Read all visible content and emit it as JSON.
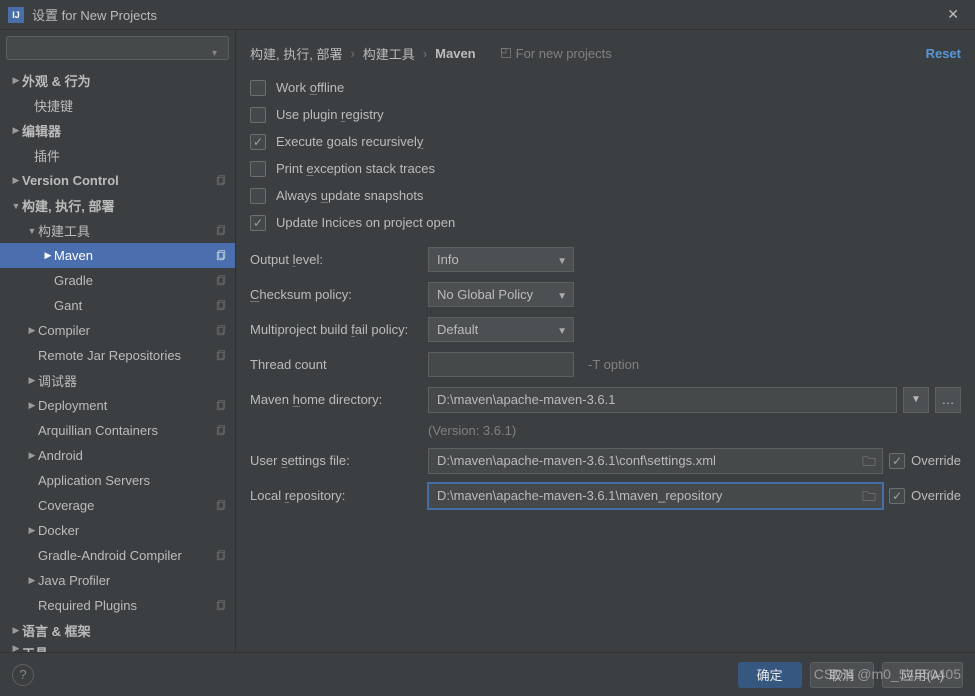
{
  "title": "设置 for New Projects",
  "reset": "Reset",
  "breadcrumb": [
    "构建, 执行, 部署",
    "构建工具",
    "Maven"
  ],
  "for_new_projects": "For new projects",
  "sidebar": [
    {
      "label": "外观 & 行为",
      "lvl": 0,
      "arrow": "right",
      "bold": true,
      "copy": false
    },
    {
      "label": "快捷键",
      "lvl": 0,
      "arrow": "",
      "bold": false,
      "copy": false,
      "extra_left": true
    },
    {
      "label": "编辑器",
      "lvl": 0,
      "arrow": "right",
      "bold": true,
      "copy": false
    },
    {
      "label": "插件",
      "lvl": 0,
      "arrow": "",
      "bold": false,
      "copy": false,
      "extra_left": true
    },
    {
      "label": "Version Control",
      "lvl": 0,
      "arrow": "right",
      "bold": true,
      "copy": true
    },
    {
      "label": "构建, 执行, 部署",
      "lvl": 0,
      "arrow": "down",
      "bold": true,
      "copy": false
    },
    {
      "label": "构建工具",
      "lvl": 1,
      "arrow": "down",
      "bold": false,
      "copy": true
    },
    {
      "label": "Maven",
      "lvl": 2,
      "arrow": "right",
      "bold": false,
      "copy": true,
      "selected": true
    },
    {
      "label": "Gradle",
      "lvl": 2,
      "arrow": "",
      "bold": false,
      "copy": true
    },
    {
      "label": "Gant",
      "lvl": 2,
      "arrow": "",
      "bold": false,
      "copy": true
    },
    {
      "label": "Compiler",
      "lvl": 1,
      "arrow": "right",
      "bold": false,
      "copy": true
    },
    {
      "label": "Remote Jar Repositories",
      "lvl": 1,
      "arrow": "",
      "bold": false,
      "copy": true
    },
    {
      "label": "调试器",
      "lvl": 1,
      "arrow": "right",
      "bold": false,
      "copy": false
    },
    {
      "label": "Deployment",
      "lvl": 1,
      "arrow": "right",
      "bold": false,
      "copy": true
    },
    {
      "label": "Arquillian Containers",
      "lvl": 1,
      "arrow": "",
      "bold": false,
      "copy": true
    },
    {
      "label": "Android",
      "lvl": 1,
      "arrow": "right",
      "bold": false,
      "copy": false
    },
    {
      "label": "Application Servers",
      "lvl": 1,
      "arrow": "",
      "bold": false,
      "copy": false
    },
    {
      "label": "Coverage",
      "lvl": 1,
      "arrow": "",
      "bold": false,
      "copy": true
    },
    {
      "label": "Docker",
      "lvl": 1,
      "arrow": "right",
      "bold": false,
      "copy": false
    },
    {
      "label": "Gradle-Android Compiler",
      "lvl": 1,
      "arrow": "",
      "bold": false,
      "copy": true
    },
    {
      "label": "Java Profiler",
      "lvl": 1,
      "arrow": "right",
      "bold": false,
      "copy": false
    },
    {
      "label": "Required Plugins",
      "lvl": 1,
      "arrow": "",
      "bold": false,
      "copy": true
    },
    {
      "label": "语言 & 框架",
      "lvl": 0,
      "arrow": "right",
      "bold": true,
      "copy": false
    },
    {
      "label": "工具",
      "lvl": 0,
      "arrow": "right",
      "bold": true,
      "copy": false,
      "cut": true
    }
  ],
  "checks": {
    "work_offline": {
      "pre": "Work ",
      "u": "o",
      "post": "ffline",
      "checked": false
    },
    "use_plugin": {
      "pre": "Use plugin ",
      "u": "r",
      "post": "egistry",
      "checked": false
    },
    "execute_goals": {
      "pre": "Execute goals recursivel",
      "u": "y",
      "post": "",
      "checked": true
    },
    "print_exception": {
      "pre": "Print ",
      "u": "e",
      "post": "xception stack traces",
      "checked": false
    },
    "always_update": {
      "pre": "Always ",
      "u": "u",
      "post": "pdate snapshots",
      "checked": false
    },
    "update_indices": {
      "plain": "Update Incices on project open",
      "checked": true
    }
  },
  "fields": {
    "output_level": {
      "pre": "Output ",
      "u": "l",
      "post": "evel:",
      "value": "Info"
    },
    "checksum": {
      "pre": "",
      "u": "C",
      "post": "hecksum policy:",
      "value": "No Global Policy"
    },
    "multiproject": {
      "pre": "Multiproject build ",
      "u": "f",
      "post": "ail policy:",
      "value": "Default"
    },
    "thread": {
      "label": "Thread count",
      "value": "",
      "hint": "-T option"
    },
    "maven_home": {
      "pre": "Maven ",
      "u": "h",
      "post": "ome directory:",
      "value": "D:\\maven\\apache-maven-3.6.1"
    },
    "version_note": "(Version: 3.6.1)",
    "user_settings": {
      "pre": "User ",
      "u": "s",
      "post": "ettings file:",
      "value": "D:\\maven\\apache-maven-3.6.1\\conf\\settings.xml",
      "override": "Override"
    },
    "local_repo": {
      "pre": "Local ",
      "u": "r",
      "post": "epository:",
      "value": "D:\\maven\\apache-maven-3.6.1\\maven_repository",
      "override": "Override"
    }
  },
  "buttons": {
    "ok": "确定",
    "cancel": "取消",
    "apply": "应用(A)"
  },
  "watermark": "CSDN @m0_54550405"
}
